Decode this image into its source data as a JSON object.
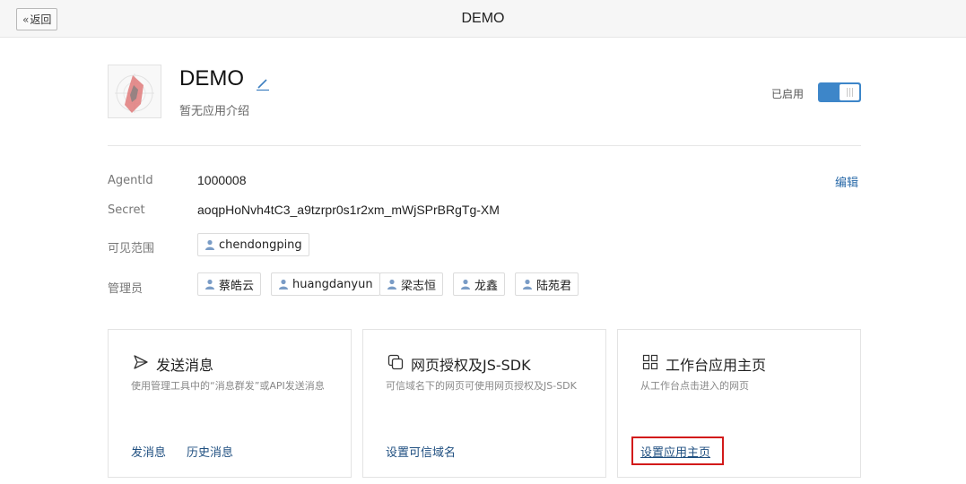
{
  "topbar": {
    "back_label": "返回",
    "title": "DEMO"
  },
  "app": {
    "name": "DEMO",
    "description": "暂无应用介绍"
  },
  "status": {
    "label": "已启用",
    "enabled": true,
    "accent": "#3d86c9"
  },
  "details": {
    "agentid_label": "AgentId",
    "agentid_value": "1000008",
    "edit_label": "编辑",
    "secret_label": "Secret",
    "secret_value": "aoqpHoNvh4tC3_a9tzrpr0s1r2xm_mWjSPrBRgTg-XM",
    "visible_label": "可见范围",
    "visible_users": [
      "chendongping"
    ],
    "admin_label": "管理员",
    "admins": [
      "蔡皓云",
      "huangdanyun",
      "梁志恒",
      "龙鑫",
      "陆苑君"
    ]
  },
  "cards": [
    {
      "icon": "send-icon",
      "title": "发送消息",
      "desc": "使用管理工具中的“消息群发”或API发送消息",
      "links": [
        "发消息",
        "历史消息"
      ]
    },
    {
      "icon": "copy-squares-icon",
      "title": "网页授权及JS-SDK",
      "desc": "可信域名下的网页可使用网页授权及JS-SDK",
      "links": [
        "设置可信域名"
      ]
    },
    {
      "icon": "grid-icon",
      "title": "工作台应用主页",
      "desc": "从工作台点击进入的网页",
      "links": [
        "设置应用主页"
      ]
    }
  ],
  "colors": {
    "link": "#1f4f80",
    "highlight": "#d21a1a"
  }
}
